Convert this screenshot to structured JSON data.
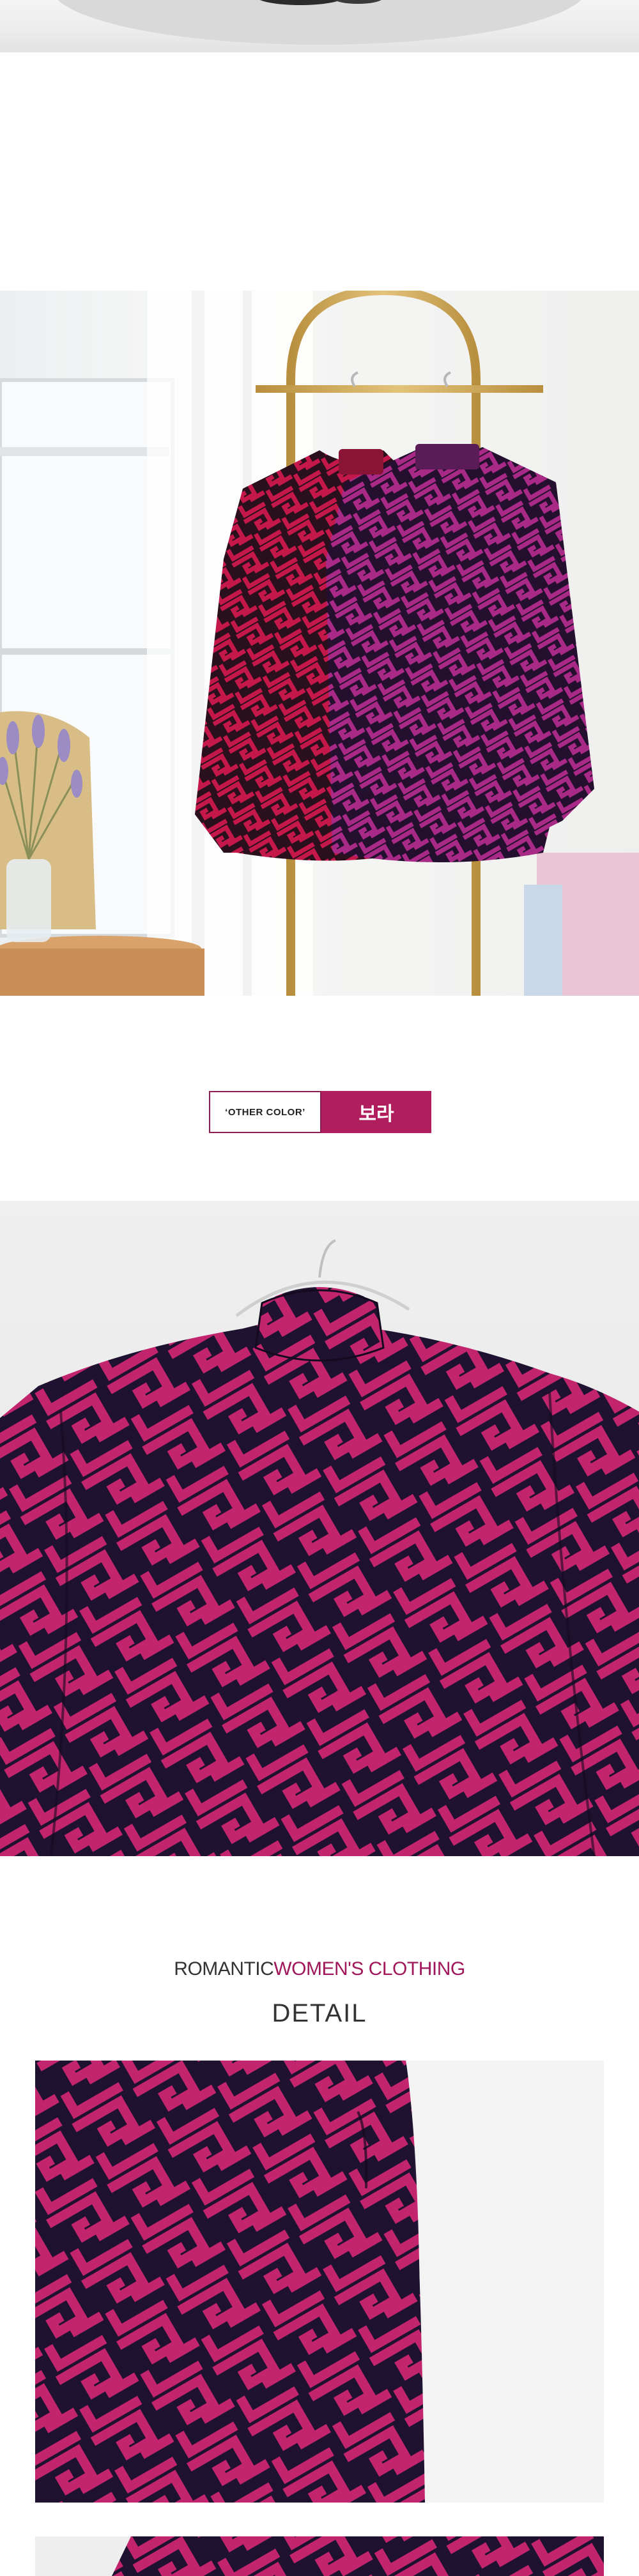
{
  "badge": {
    "other_color_label": "‘OTHER COLOR’",
    "color_name": "보라"
  },
  "heading": {
    "romantic": "ROMANTIC",
    "womens_clothing": "WOMEN'S CLOTHING",
    "detail": "DETAIL"
  },
  "colors": {
    "accent": "#b01e5e",
    "accent_text": "#a0185a",
    "pattern_navy": "#1e1230",
    "pattern_magenta": "#c0246c",
    "pattern_red": "#c4174a",
    "brass": "#c9a554"
  },
  "images": {
    "top_strip": "cropped-photo-strip",
    "rack_photo": "two-patterned-tops-on-brass-rack",
    "closeup_photo": "patterned-top-on-hanger-closeup",
    "detail_photo_1": "sleeve-pattern-detail",
    "detail_photo_2": "pattern-detail-continued"
  }
}
